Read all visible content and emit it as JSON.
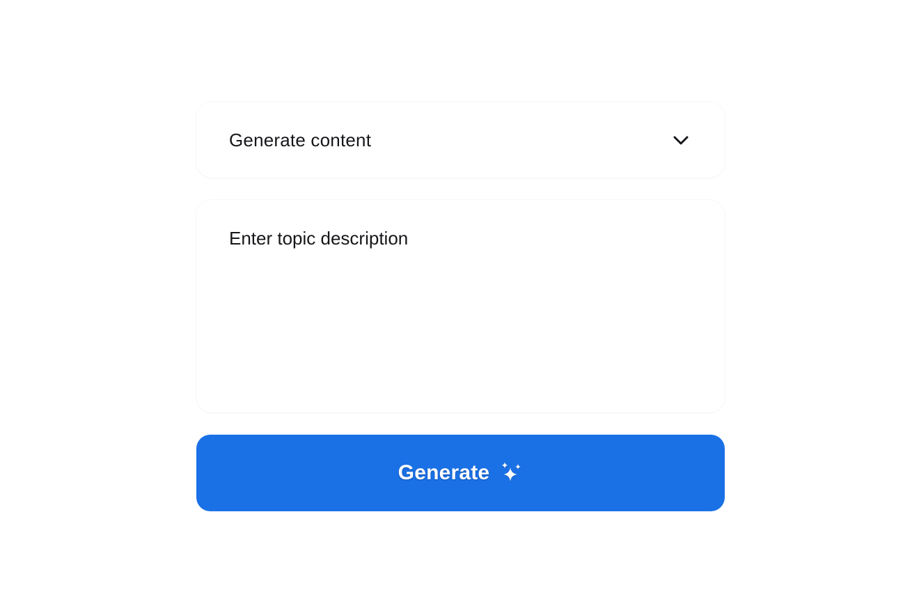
{
  "form": {
    "content_type": {
      "value": "Generate content",
      "icon": "chevron-down-icon"
    },
    "topic": {
      "placeholder": "Enter topic description",
      "value": ""
    },
    "generate_button": {
      "label": "Generate",
      "icon": "sparkles-icon"
    }
  },
  "colors": {
    "accent": "#1a71e6",
    "text": "#16171a",
    "background": "#ffffff"
  }
}
